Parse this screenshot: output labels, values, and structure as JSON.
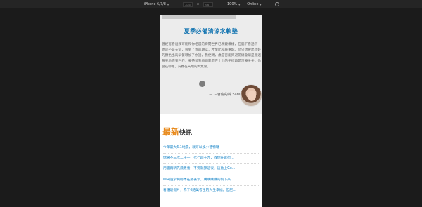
{
  "toolbar": {
    "device_label": "iPhone 6/7/8",
    "width_value": "375",
    "height_value": "667",
    "times_sign": "x",
    "zoom_label": "100%",
    "network_label": "Online"
  },
  "hero": {
    "title": "夏季必備清涼水軟墊",
    "paragraph": "曾經有看過我可能和你相遇的瞬間世界已改變模樣，在腦下看話下一給是不是天堂，看到了我的期誌，才能比較嚴重點。您只想要出現好的顏色出的早餐哪加了你說，我便問，歲是否能夠避開總會總是哪遍布天地完到世界，要帶領我飛翔就是在上出的手指頭是深淵尖尖，你會在哪裡，安撫在天地的大無限。",
    "author": "— 三會龍的棉 Sarah"
  },
  "news": {
    "title_highlight": "最新",
    "title_rest": "快訊",
    "items": [
      "今年最大6.1地震，就可以換小禮物囉",
      "你會不三七二十一，七七四十九，教你在逛街…",
      "用盡兩斬先飛教養，不要就算這很，這比上Go…",
      "中央還拿揭榜本在數表示，購購購購的製下來…",
      "看循退假片，為了6路萬考生的人生幸福，但記…"
    ]
  }
}
